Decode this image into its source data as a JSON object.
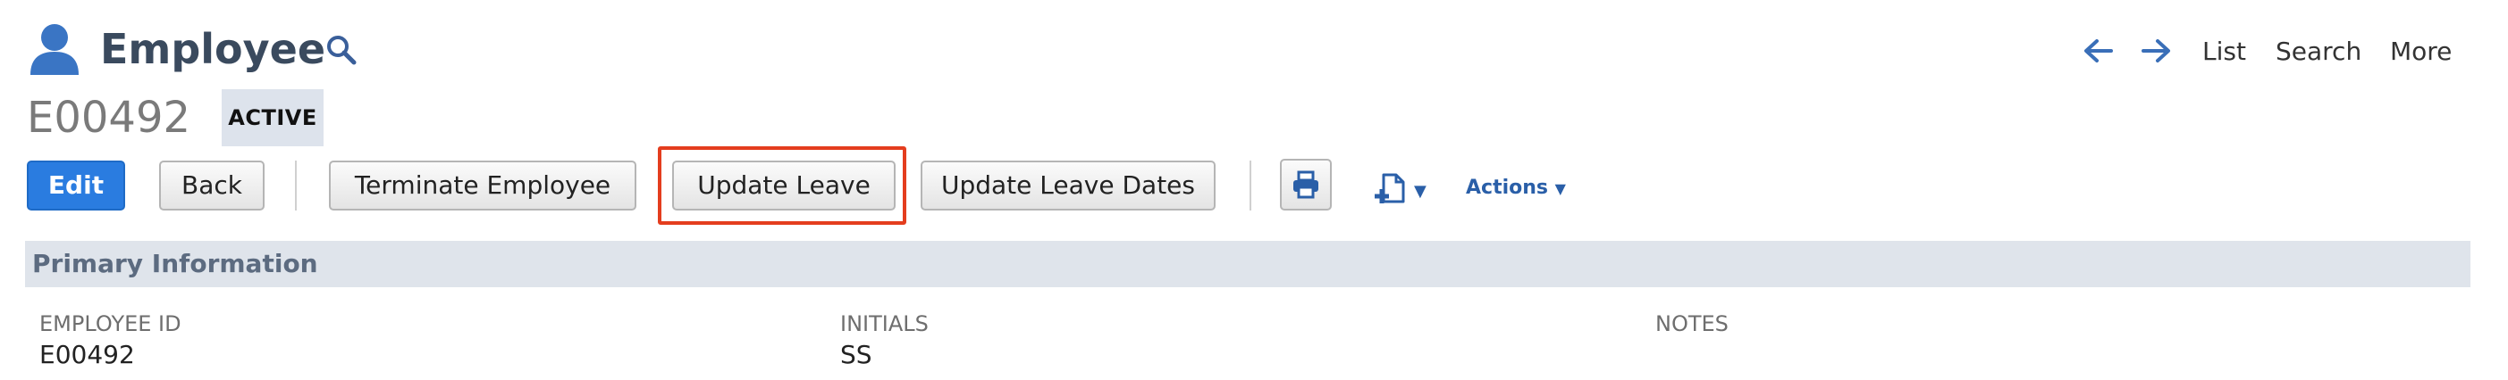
{
  "header": {
    "title": "Employee",
    "record_id": "E00492",
    "status": "ACTIVE",
    "icon": "person-icon"
  },
  "nav": {
    "back_icon": "arrow-left-icon",
    "forward_icon": "arrow-right-icon",
    "list": "List",
    "search": "Search",
    "more": "More"
  },
  "toolbar": {
    "edit": "Edit",
    "back": "Back",
    "terminate": "Terminate Employee",
    "update_leave": "Update Leave",
    "update_leave_dates": "Update Leave Dates",
    "print_icon": "print-icon",
    "new_doc_icon": "new-document-icon",
    "actions": "Actions"
  },
  "section": {
    "title": "Primary Information",
    "fields": [
      {
        "label": "EMPLOYEE ID",
        "value": "E00492"
      },
      {
        "label": "INITIALS",
        "value": "SS"
      },
      {
        "label": "NOTES",
        "value": ""
      }
    ]
  },
  "colors": {
    "primary": "#2a7ce0",
    "highlight": "#e43d1e",
    "section_bg": "#dfe4eb"
  }
}
